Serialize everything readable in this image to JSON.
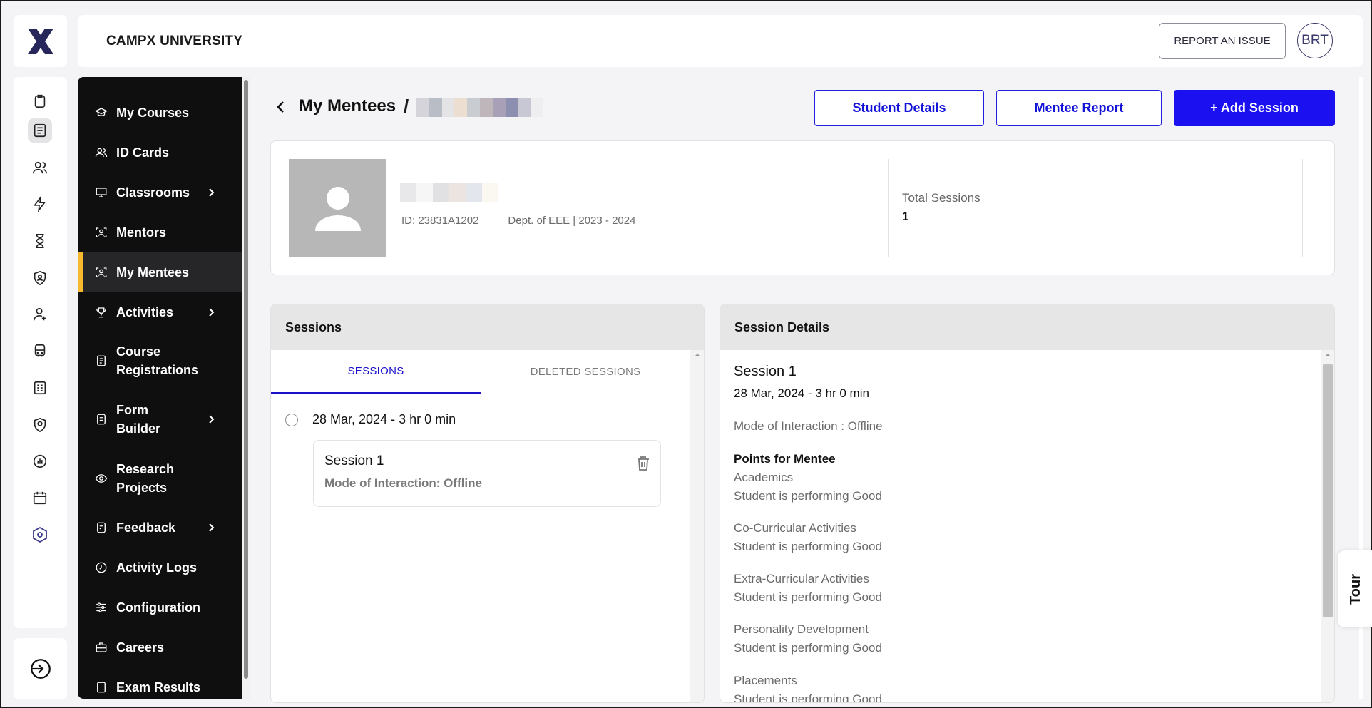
{
  "header": {
    "university": "CAMPX UNIVERSITY",
    "report_label": "REPORT AN ISSUE",
    "avatar_initials": "BRT"
  },
  "sidebar": {
    "items": [
      {
        "label": "My Courses",
        "icon": "graduation-cap-icon",
        "chevron": false
      },
      {
        "label": "ID Cards",
        "icon": "users-icon",
        "chevron": false
      },
      {
        "label": "Classrooms",
        "icon": "presentation-board-icon",
        "chevron": true
      },
      {
        "label": "Mentors",
        "icon": "face-scan-icon",
        "chevron": false
      },
      {
        "label": "My Mentees",
        "icon": "face-scan-icon",
        "chevron": false,
        "active": true
      },
      {
        "label": "Activities",
        "icon": "trophy-icon",
        "chevron": true
      },
      {
        "label": "Course Registrations",
        "icon": "document-icon",
        "chevron": false
      },
      {
        "label": "Form Builder",
        "icon": "form-icon",
        "chevron": true
      },
      {
        "label": "Research Projects",
        "icon": "eye-icon",
        "chevron": false
      },
      {
        "label": "Feedback",
        "icon": "feedback-icon",
        "chevron": true
      },
      {
        "label": "Activity Logs",
        "icon": "clock-icon",
        "chevron": false
      },
      {
        "label": "Configuration",
        "icon": "sliders-icon",
        "chevron": false
      },
      {
        "label": "Careers",
        "icon": "briefcase-icon",
        "chevron": false
      },
      {
        "label": "Exam Results",
        "icon": "exam-icon",
        "chevron": false
      }
    ]
  },
  "page": {
    "breadcrumb": "My Mentees",
    "separator": "/",
    "buttons": {
      "student_details": "Student Details",
      "mentee_report": "Mentee Report",
      "add_session": "+ Add Session"
    }
  },
  "profile": {
    "id_text": "ID: 23831A1202",
    "dept_text": "Dept. of EEE | 2023 - 2024",
    "total_sessions_label": "Total Sessions",
    "total_sessions_value": "1"
  },
  "sessions_panel": {
    "title": "Sessions",
    "tabs": [
      "SESSIONS",
      "DELETED SESSIONS"
    ],
    "entry": {
      "date": "28 Mar, 2024 - 3 hr 0 min",
      "title": "Session 1",
      "mode": "Mode of Interaction: Offline"
    }
  },
  "details_panel": {
    "title": "Session Details",
    "session_title": "Session 1",
    "date": "28 Mar, 2024 - 3 hr 0 min",
    "mode": "Mode of Interaction : Offline",
    "points_heading": "Points for Mentee",
    "points": [
      {
        "category": "Academics",
        "remark": "Student is performing Good"
      },
      {
        "category": "Co-Curricular Activities",
        "remark": "Student is performing Good"
      },
      {
        "category": "Extra-Curricular Activities",
        "remark": "Student is performing Good"
      },
      {
        "category": "Personality Development",
        "remark": "Student is performing Good"
      },
      {
        "category": "Placements",
        "remark": "Student is performing Good"
      }
    ]
  },
  "tour_label": "Tour",
  "colors": {
    "primary": "#1a10f0",
    "sidebar_bg": "#0f0f10",
    "active_accent": "#f5b82e"
  }
}
